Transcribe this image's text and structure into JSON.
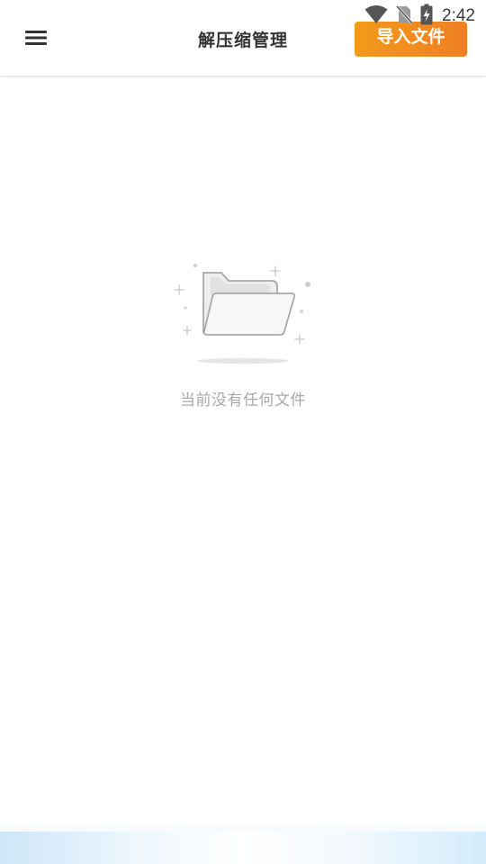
{
  "status_bar": {
    "time": "2:42",
    "icons": [
      "wifi-icon",
      "no-sim-icon",
      "battery-charging-icon"
    ]
  },
  "app_bar": {
    "title": "解压缩管理",
    "menu_icon": "hamburger-menu-icon",
    "import_button_label": "导入文件"
  },
  "empty_state": {
    "illustration_icon": "empty-folder-icon",
    "message": "当前没有任何文件"
  },
  "colors": {
    "accent": "#f39a1a",
    "accent_end": "#f07f22",
    "title_text": "#333333",
    "empty_text": "#a8a8a8",
    "background": "#ffffff"
  }
}
